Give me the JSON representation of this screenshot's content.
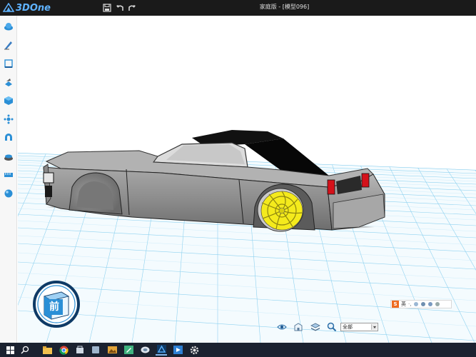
{
  "app": {
    "logo_text": "3DOne",
    "document_title": "家庭版 - [模型096]"
  },
  "titlebar": {
    "save_icon": "save-icon",
    "undo_icon": "undo-icon",
    "redo_icon": "redo-icon"
  },
  "left_toolbar": [
    "basic-shape-icon",
    "sketch-icon",
    "sketch-edit-icon",
    "special-features-icon",
    "basic-edit-icon",
    "auto-snap-icon",
    "combine-icon",
    "material-render-icon",
    "measure-icon",
    "color-icon"
  ],
  "viewcube": {
    "label": "前"
  },
  "bottom_toolbar": {
    "filter_value": "全部"
  },
  "ime": {
    "brand": "S",
    "language": "英"
  },
  "colors": {
    "titlebar": "#1a1a1a",
    "grid": "#6fc3ea",
    "accent_blue": "#2b8fd6",
    "wheel": "#f4ea1c",
    "taillight": "#d4111a",
    "taskbar": "#1b2230"
  },
  "taskbar": [
    "windows-start-icon",
    "search-icon",
    "file-explorer-icon",
    "chrome-icon",
    "store-icon",
    "app-icon",
    "image-viewer-icon",
    "pen-app-icon",
    "messaging-icon",
    "3done-taskbar-icon",
    "media-icon",
    "settings-icon"
  ]
}
